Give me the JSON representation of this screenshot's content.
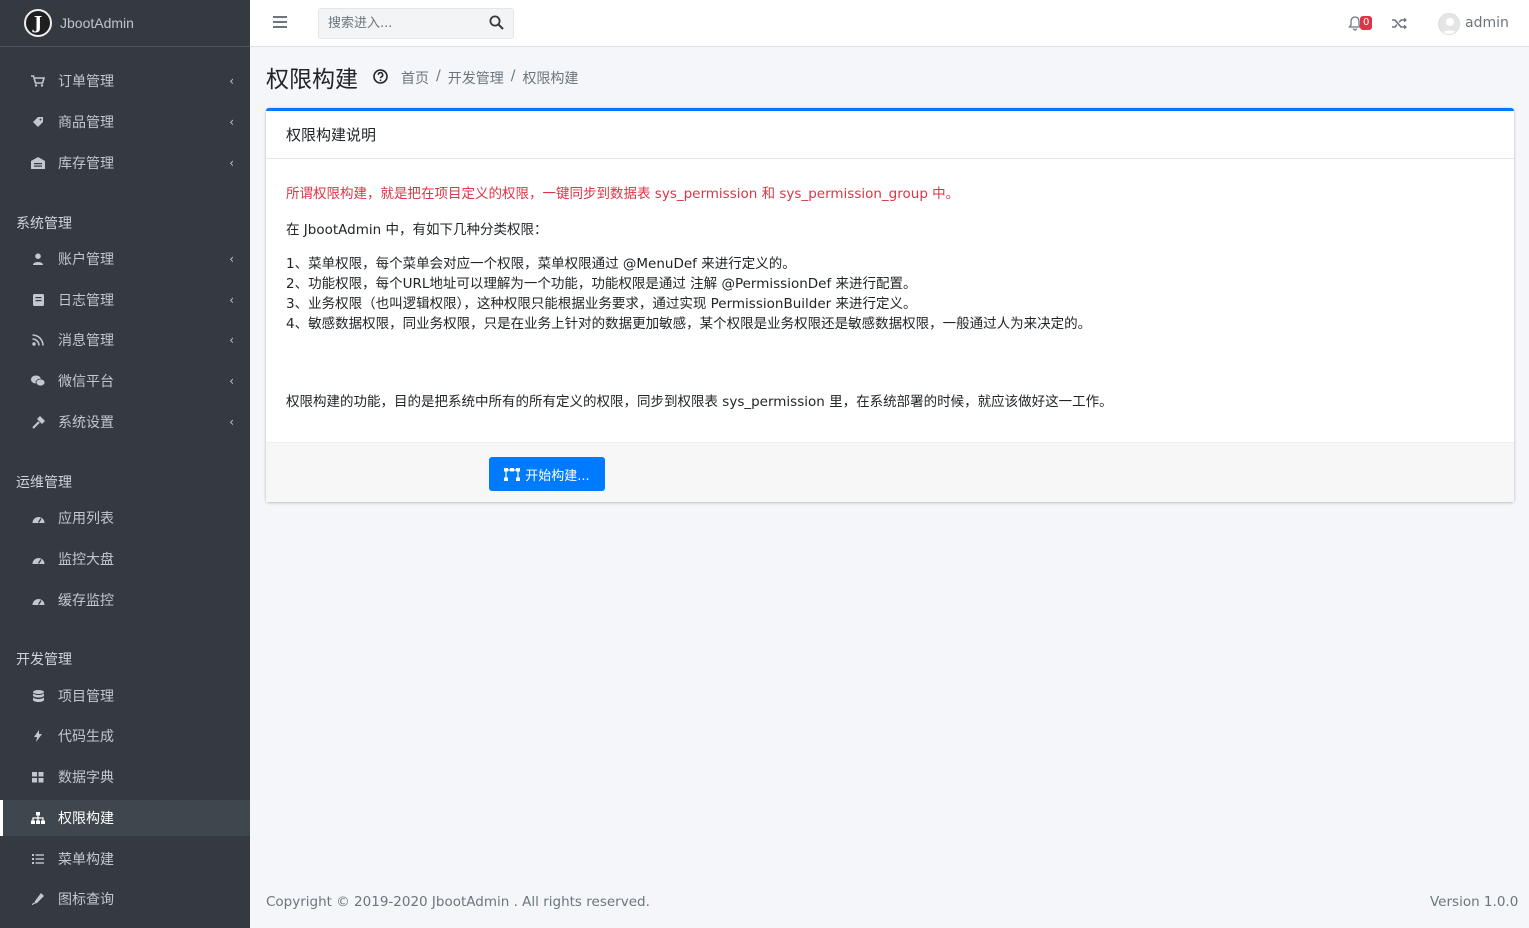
{
  "brand": {
    "logo_letter": "J",
    "name": "JbootAdmin"
  },
  "sidebar": {
    "items": [
      {
        "label": "订单管理",
        "icon": "cart-icon",
        "has_chevron": true
      },
      {
        "label": "商品管理",
        "icon": "tag-icon",
        "has_chevron": true
      },
      {
        "label": "库存管理",
        "icon": "warehouse-icon",
        "has_chevron": true
      }
    ],
    "sections": [
      {
        "header": "系统管理",
        "items": [
          {
            "label": "账户管理",
            "icon": "user-icon",
            "has_chevron": true
          },
          {
            "label": "日志管理",
            "icon": "book-icon",
            "has_chevron": true
          },
          {
            "label": "消息管理",
            "icon": "feed-icon",
            "has_chevron": true
          },
          {
            "label": "微信平台",
            "icon": "wechat-icon",
            "has_chevron": true
          },
          {
            "label": "系统设置",
            "icon": "hammer-icon",
            "has_chevron": true
          }
        ]
      },
      {
        "header": "运维管理",
        "items": [
          {
            "label": "应用列表",
            "icon": "dashboard-icon"
          },
          {
            "label": "监控大盘",
            "icon": "dashboard-icon"
          },
          {
            "label": "缓存监控",
            "icon": "dashboard-icon"
          }
        ]
      },
      {
        "header": "开发管理",
        "items": [
          {
            "label": "项目管理",
            "icon": "database-icon"
          },
          {
            "label": "代码生成",
            "icon": "bolt-icon"
          },
          {
            "label": "数据字典",
            "icon": "grid-icon"
          },
          {
            "label": "权限构建",
            "icon": "sitemap-icon",
            "active": true
          },
          {
            "label": "菜单构建",
            "icon": "list-icon"
          },
          {
            "label": "图标查询",
            "icon": "pen-icon"
          }
        ]
      }
    ]
  },
  "topbar": {
    "search_placeholder": "搜索进入...",
    "notification_count": "0",
    "user_name": "admin"
  },
  "page": {
    "title": "权限构建",
    "breadcrumb": [
      "首页",
      "开发管理",
      "权限构建"
    ]
  },
  "card": {
    "header": "权限构建说明",
    "intro_red": "所谓权限构建，就是把在项目定义的权限，一键同步到数据表 sys_permission 和 sys_permission_group 中。",
    "intro": "在 JbootAdmin 中，有如下几种分类权限：",
    "list": [
      "1、菜单权限，每个菜单会对应一个权限，菜单权限通过 @MenuDef 来进行定义的。",
      "2、功能权限，每个URL地址可以理解为一个功能，功能权限是通过 注解 @PermissionDef 来进行配置。",
      "3、业务权限（也叫逻辑权限），这种权限只能根据业务要求，通过实现 PermissionBuilder 来进行定义。",
      "4、敏感数据权限，同业务权限，只是在业务上针对的数据更加敏感，某个权限是业务权限还是敏感数据权限，一般通过人为来决定的。"
    ],
    "summary": "权限构建的功能，目的是把系统中所有的所有定义的权限，同步到权限表 sys_permission 里，在系统部署的时候，就应该做好这一工作。",
    "button_label": "开始构建..."
  },
  "footer": {
    "copyright": "Copyright © 2019-2020 JbootAdmin . All rights reserved.",
    "version": "Version 1.0.0"
  },
  "colors": {
    "sidebar_bg": "#343a40",
    "primary": "#007bff",
    "danger": "#dc3545"
  }
}
